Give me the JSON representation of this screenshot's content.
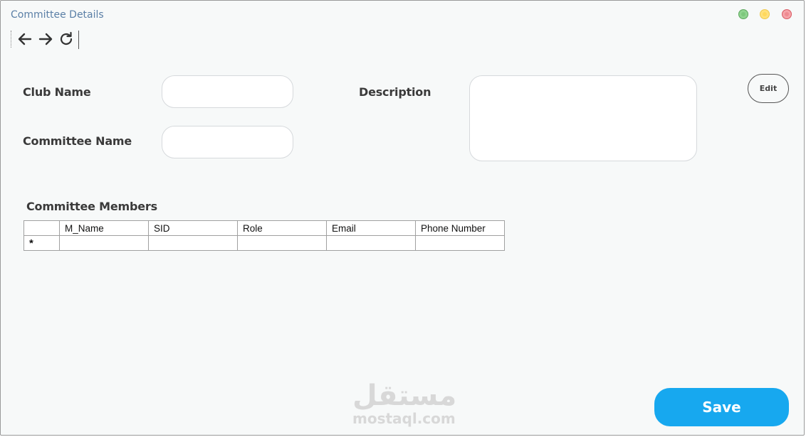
{
  "window": {
    "title": "Committee Details"
  },
  "toolbar": {
    "back_icon": "arrow-left-icon",
    "forward_icon": "arrow-right-icon",
    "refresh_icon": "refresh-icon"
  },
  "form": {
    "club_name_label": "Club Name",
    "club_name_value": "",
    "committee_name_label": "Committee Name",
    "committee_name_value": "",
    "description_label": "Description",
    "description_value": "",
    "edit_label": "Edit"
  },
  "members": {
    "title": "Committee Members",
    "columns": [
      "M_Name",
      "SID",
      "Role",
      "Email",
      "Phone Number"
    ],
    "new_row_marker": "*"
  },
  "watermark": {
    "arabic": "مستقل",
    "latin": "mostaql.com"
  },
  "actions": {
    "save_label": "Save"
  },
  "colors": {
    "accent": "#17a8ef",
    "title": "#5a7fa6"
  }
}
